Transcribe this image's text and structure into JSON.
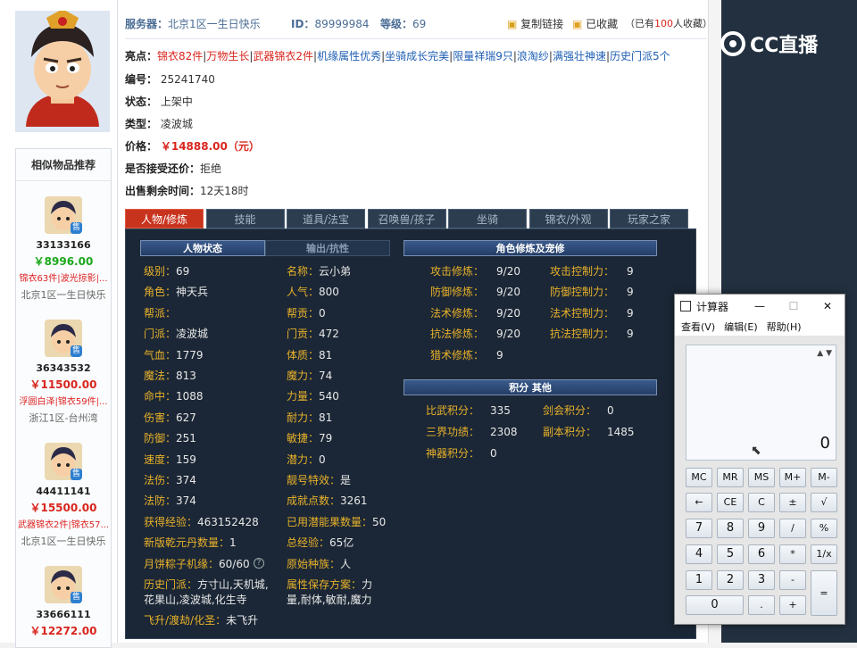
{
  "header": {
    "server_label": "服务器：",
    "server_value": "北京1区一生日快乐",
    "id_label": "ID：",
    "id_value": "89999984",
    "level_label": "等级：",
    "level_value": "69",
    "copy_link": "复制链接",
    "favorited": "已收藏",
    "fav_prefix": "（已有",
    "fav_count": "100",
    "fav_suffix": "人收藏）"
  },
  "item": {
    "highlights_label": "亮点：",
    "highlights": [
      {
        "text": "锦衣82件",
        "color": "#d8261e"
      },
      {
        "text": "万物生长",
        "color": "#d8261e"
      },
      {
        "text": "武器锦衣2件",
        "color": "#d8261e"
      },
      {
        "text": "机缘属性优秀",
        "color": "#1f5fb4"
      },
      {
        "text": "坐骑成长完美",
        "color": "#1f5fb4"
      },
      {
        "text": "限量祥瑞9只",
        "color": "#1f5fb4"
      },
      {
        "text": "浪淘纱",
        "color": "#1f5fb4"
      },
      {
        "text": "满强壮神速",
        "color": "#1f5fb4"
      },
      {
        "text": "历史门派5个",
        "color": "#1f5fb4"
      }
    ],
    "number_label": "编号：",
    "number": "25241740",
    "status_label": "状态：",
    "status": "上架中",
    "type_label": "类型：",
    "type": "凌波城",
    "price_label": "价格：",
    "price": "￥14888.00（元）",
    "counter_label": "是否接受还价：",
    "counter": "拒绝",
    "remain_label": "出售剩余时间：",
    "remain": "12天18时"
  },
  "similar": {
    "title": "相似物品推荐",
    "items": [
      {
        "id": "33133166",
        "price": "￥8996.00",
        "price_color": "#1aa81a",
        "tags": "锦衣63件|波光掠影|...",
        "server": "北京1区一生日快乐"
      },
      {
        "id": "36343532",
        "price": "￥11500.00",
        "price_color": "#d8261e",
        "tags": "浮圆白泽|锦衣59件|...",
        "server": "浙江1区-台州湾"
      },
      {
        "id": "44411141",
        "price": "￥15500.00",
        "price_color": "#d8261e",
        "tags": "武器锦衣2件|锦衣57...",
        "server": "北京1区一生日快乐"
      },
      {
        "id": "33666111",
        "price": "￥12272.00",
        "price_color": "#d8261e",
        "tags": "",
        "server": ""
      }
    ],
    "sell_badge": "售"
  },
  "tabs": [
    "人物/修炼",
    "技能",
    "道具/法宝",
    "召唤兽/孩子",
    "坐骑",
    "锦衣/外观",
    "玩家之家"
  ],
  "panel": {
    "char_status": "人物状态",
    "output_resist": "输出/抗性",
    "cultivation": "角色修炼及宠修",
    "points": "积分 其他",
    "left_col": [
      [
        "级别：",
        "69"
      ],
      [
        "角色：",
        "神天兵"
      ],
      [
        "帮派：",
        ""
      ],
      [
        "门派：",
        "凌波城"
      ],
      [
        "气血：",
        "1779"
      ],
      [
        "魔法：",
        "813"
      ],
      [
        "命中：",
        "1088"
      ],
      [
        "伤害：",
        "627"
      ],
      [
        "防御：",
        "251"
      ],
      [
        "速度：",
        "159"
      ],
      [
        "法伤：",
        "374"
      ],
      [
        "法防：",
        "374"
      ],
      [
        "获得经验：",
        "463152428"
      ],
      [
        "新版乾元丹数量：",
        "1"
      ],
      [
        "月饼粽子机缘：",
        "60/60"
      ]
    ],
    "right_col": [
      [
        "名称：",
        "云小弟"
      ],
      [
        "人气：",
        "800"
      ],
      [
        "帮贡：",
        "0"
      ],
      [
        "门贡：",
        "472"
      ],
      [
        "体质：",
        "81"
      ],
      [
        "魔力：",
        "74"
      ],
      [
        "力量：",
        "540"
      ],
      [
        "耐力：",
        "81"
      ],
      [
        "敏捷：",
        "79"
      ],
      [
        "潜力：",
        "0"
      ],
      [
        "靓号特效：",
        "是"
      ],
      [
        "成就点数：",
        "3261"
      ],
      [
        "已用潜能果数量：",
        "50"
      ],
      [
        "总经验：",
        "65亿"
      ],
      [
        "原始种族：",
        "人"
      ]
    ],
    "history_label": "历史门派：",
    "history_value": "方寸山,天机城,",
    "history_value2": "花果山,凌波城,化生寺",
    "save_label": "属性保存方案：",
    "save_value": "力",
    "save_value2": "量,耐体,敏耐,魔力",
    "fly_label": "飞升/渡劫/化圣：",
    "fly_value": "未飞升",
    "cult": [
      [
        "攻击修炼：",
        "9/20",
        "攻击控制力：",
        "9"
      ],
      [
        "防御修炼：",
        "9/20",
        "防御控制力：",
        "9"
      ],
      [
        "法术修炼：",
        "9/20",
        "法术控制力：",
        "9"
      ],
      [
        "抗法修炼：",
        "9/20",
        "抗法控制力：",
        "9"
      ],
      [
        "猎术修炼：",
        "9",
        "",
        ""
      ]
    ],
    "pts": [
      [
        "比武积分：",
        "335",
        "剑会积分：",
        "0"
      ],
      [
        "三界功绩：",
        "2308",
        "副本积分：",
        "1485"
      ],
      [
        "神器积分：",
        "0",
        "",
        ""
      ]
    ]
  },
  "logo_text": "CC直播",
  "calc": {
    "title": "计算器",
    "menu": [
      "查看(V)",
      "编辑(E)",
      "帮助(H)"
    ],
    "display": "0",
    "rows": [
      [
        "MC",
        "MR",
        "MS",
        "M+",
        "M-"
      ],
      [
        "←",
        "CE",
        "C",
        "±",
        "√"
      ],
      [
        "7",
        "8",
        "9",
        "/",
        "%"
      ],
      [
        "4",
        "5",
        "6",
        "*",
        "1/x"
      ],
      [
        "1",
        "2",
        "3",
        "-",
        "="
      ],
      [
        "0",
        ".",
        "+"
      ]
    ]
  }
}
